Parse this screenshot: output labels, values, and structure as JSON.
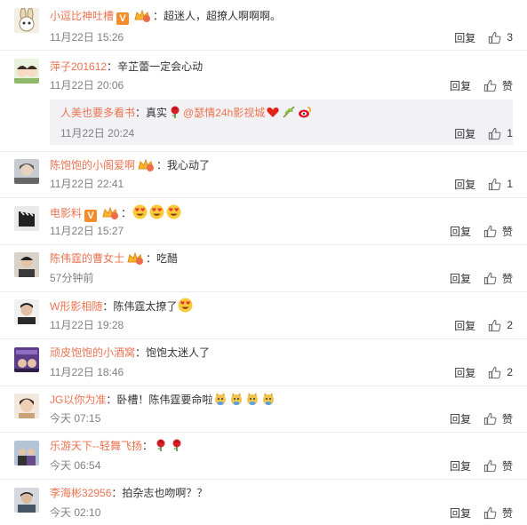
{
  "comments": [
    {
      "user": "小逗比神吐槽",
      "sep": "：",
      "text": "超迷人，超撩人啊啊啊。",
      "time": "11月22日 15:26",
      "reply": "回复",
      "likes": "3"
    },
    {
      "user": "萍子201612",
      "sep": "：",
      "text": "辛芷蕾一定会心动",
      "time": "11月22日 20:06",
      "reply": "回复",
      "likes": "赞",
      "sub": {
        "user": "人美也要多看书",
        "sep": "：",
        "text": "真实",
        "mention": "@瑟情24h影视城",
        "time": "11月22日 20:24",
        "reply": "回复",
        "likes": "1"
      }
    },
    {
      "user": "陈饱饱的小阁爱啊",
      "sep": "：",
      "text": "我心动了",
      "time": "11月22日 22:41",
      "reply": "回复",
      "likes": "1"
    },
    {
      "user": "电影料",
      "sep": "：",
      "text": "",
      "time": "11月22日 15:27",
      "reply": "回复",
      "likes": "赞"
    },
    {
      "user": "陈伟霆的曹女士",
      "sep": "：",
      "text": "吃醋",
      "time": "57分钟前",
      "reply": "回复",
      "likes": "赞"
    },
    {
      "user": "W形影相随",
      "sep": "：",
      "text": "陈伟霆太撩了",
      "time": "11月22日 19:28",
      "reply": "回复",
      "likes": "2"
    },
    {
      "user": "顽皮饱饱的小酒窝",
      "sep": "：",
      "text": "饱饱太迷人了",
      "time": "11月22日 18:46",
      "reply": "回复",
      "likes": "2"
    },
    {
      "user": "JG以你为准",
      "sep": "：",
      "text": "卧槽！陈伟霆要命啦",
      "time": "今天 07:15",
      "reply": "回复",
      "likes": "赞"
    },
    {
      "user": "乐游天下--轻舞飞扬",
      "sep": "：",
      "text": "",
      "time": "今天 06:54",
      "reply": "回复",
      "likes": "赞"
    },
    {
      "user": "李海彬32956",
      "sep": "：",
      "text": "拍杂志也吻啊？？",
      "time": "今天 02:10",
      "reply": "回复",
      "likes": "赞"
    }
  ],
  "colors": {
    "username": "#eb7350",
    "meta": "#808080",
    "subbg": "#f2f2f5",
    "badge": "#f48c2a"
  },
  "icons": [
    "thumbs-up-icon",
    "verified-badge-icon",
    "member-crown-icon",
    "heart-eyes-emoji",
    "rose-emoji",
    "red-heart-emoji",
    "weibo-logo-icon",
    "olive-branch-emoji",
    "doge-emoji"
  ]
}
